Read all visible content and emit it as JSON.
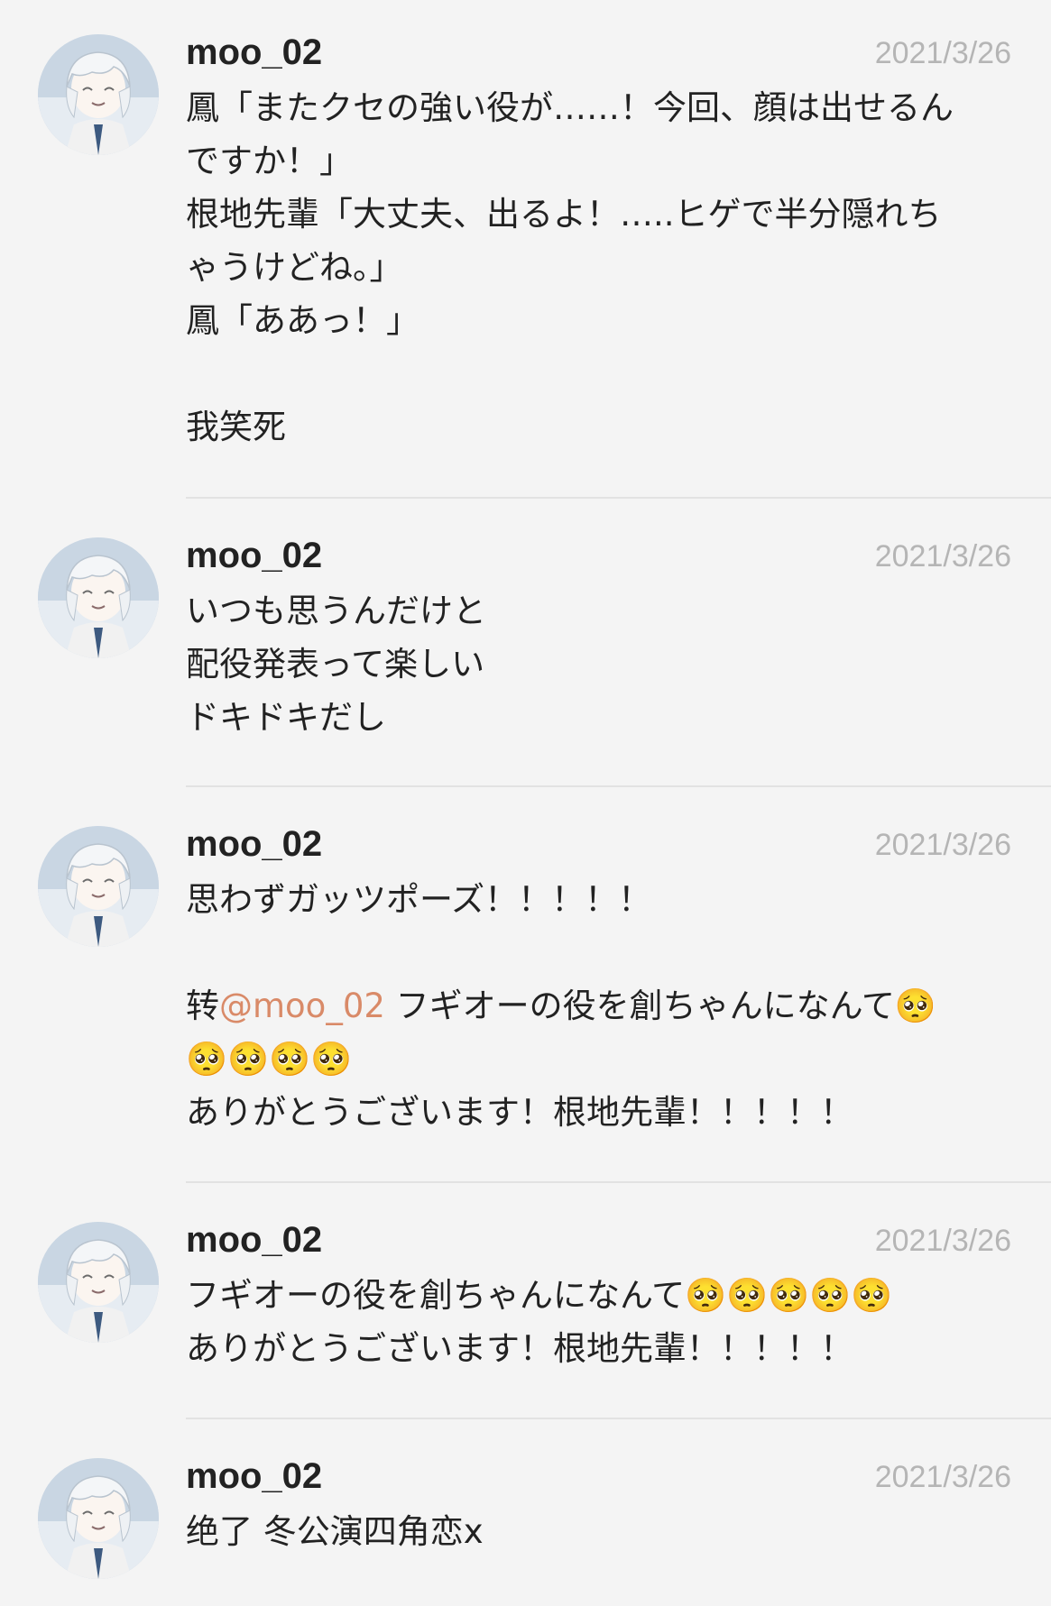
{
  "posts": [
    {
      "username": "moo_02",
      "date": "2021/3/26",
      "lines": [
        "鳳「またクセの強い役が……！今回、顔は出せるん",
        "ですか！」",
        "根地先輩「大丈夫、出るよ！…..ヒゲで半分隠れち",
        "ゃうけどね。」",
        "鳳「ああっ！」",
        "",
        "我笑死"
      ]
    },
    {
      "username": "moo_02",
      "date": "2021/3/26",
      "lines": [
        "いつも思うんだけと",
        "配役発表って楽しい",
        "ドキドキだし"
      ]
    },
    {
      "username": "moo_02",
      "date": "2021/3/26",
      "lines": [
        "思わずガッツポーズ！！！！！",
        ""
      ],
      "repost": {
        "prefix": "转",
        "mention": "@moo_02",
        "text": " フギオーの役を創ちゃんになんて🥺",
        "line2": "🥺🥺🥺🥺",
        "line3": "ありがとうございます！根地先輩！！！！！"
      }
    },
    {
      "username": "moo_02",
      "date": "2021/3/26",
      "lines": [
        "フギオーの役を創ちゃんになんて🥺🥺🥺🥺🥺",
        "ありがとうございます！根地先輩！！！！！"
      ]
    },
    {
      "username": "moo_02",
      "date": "2021/3/26",
      "lines": [
        "绝了 冬公演四角恋x"
      ]
    }
  ]
}
